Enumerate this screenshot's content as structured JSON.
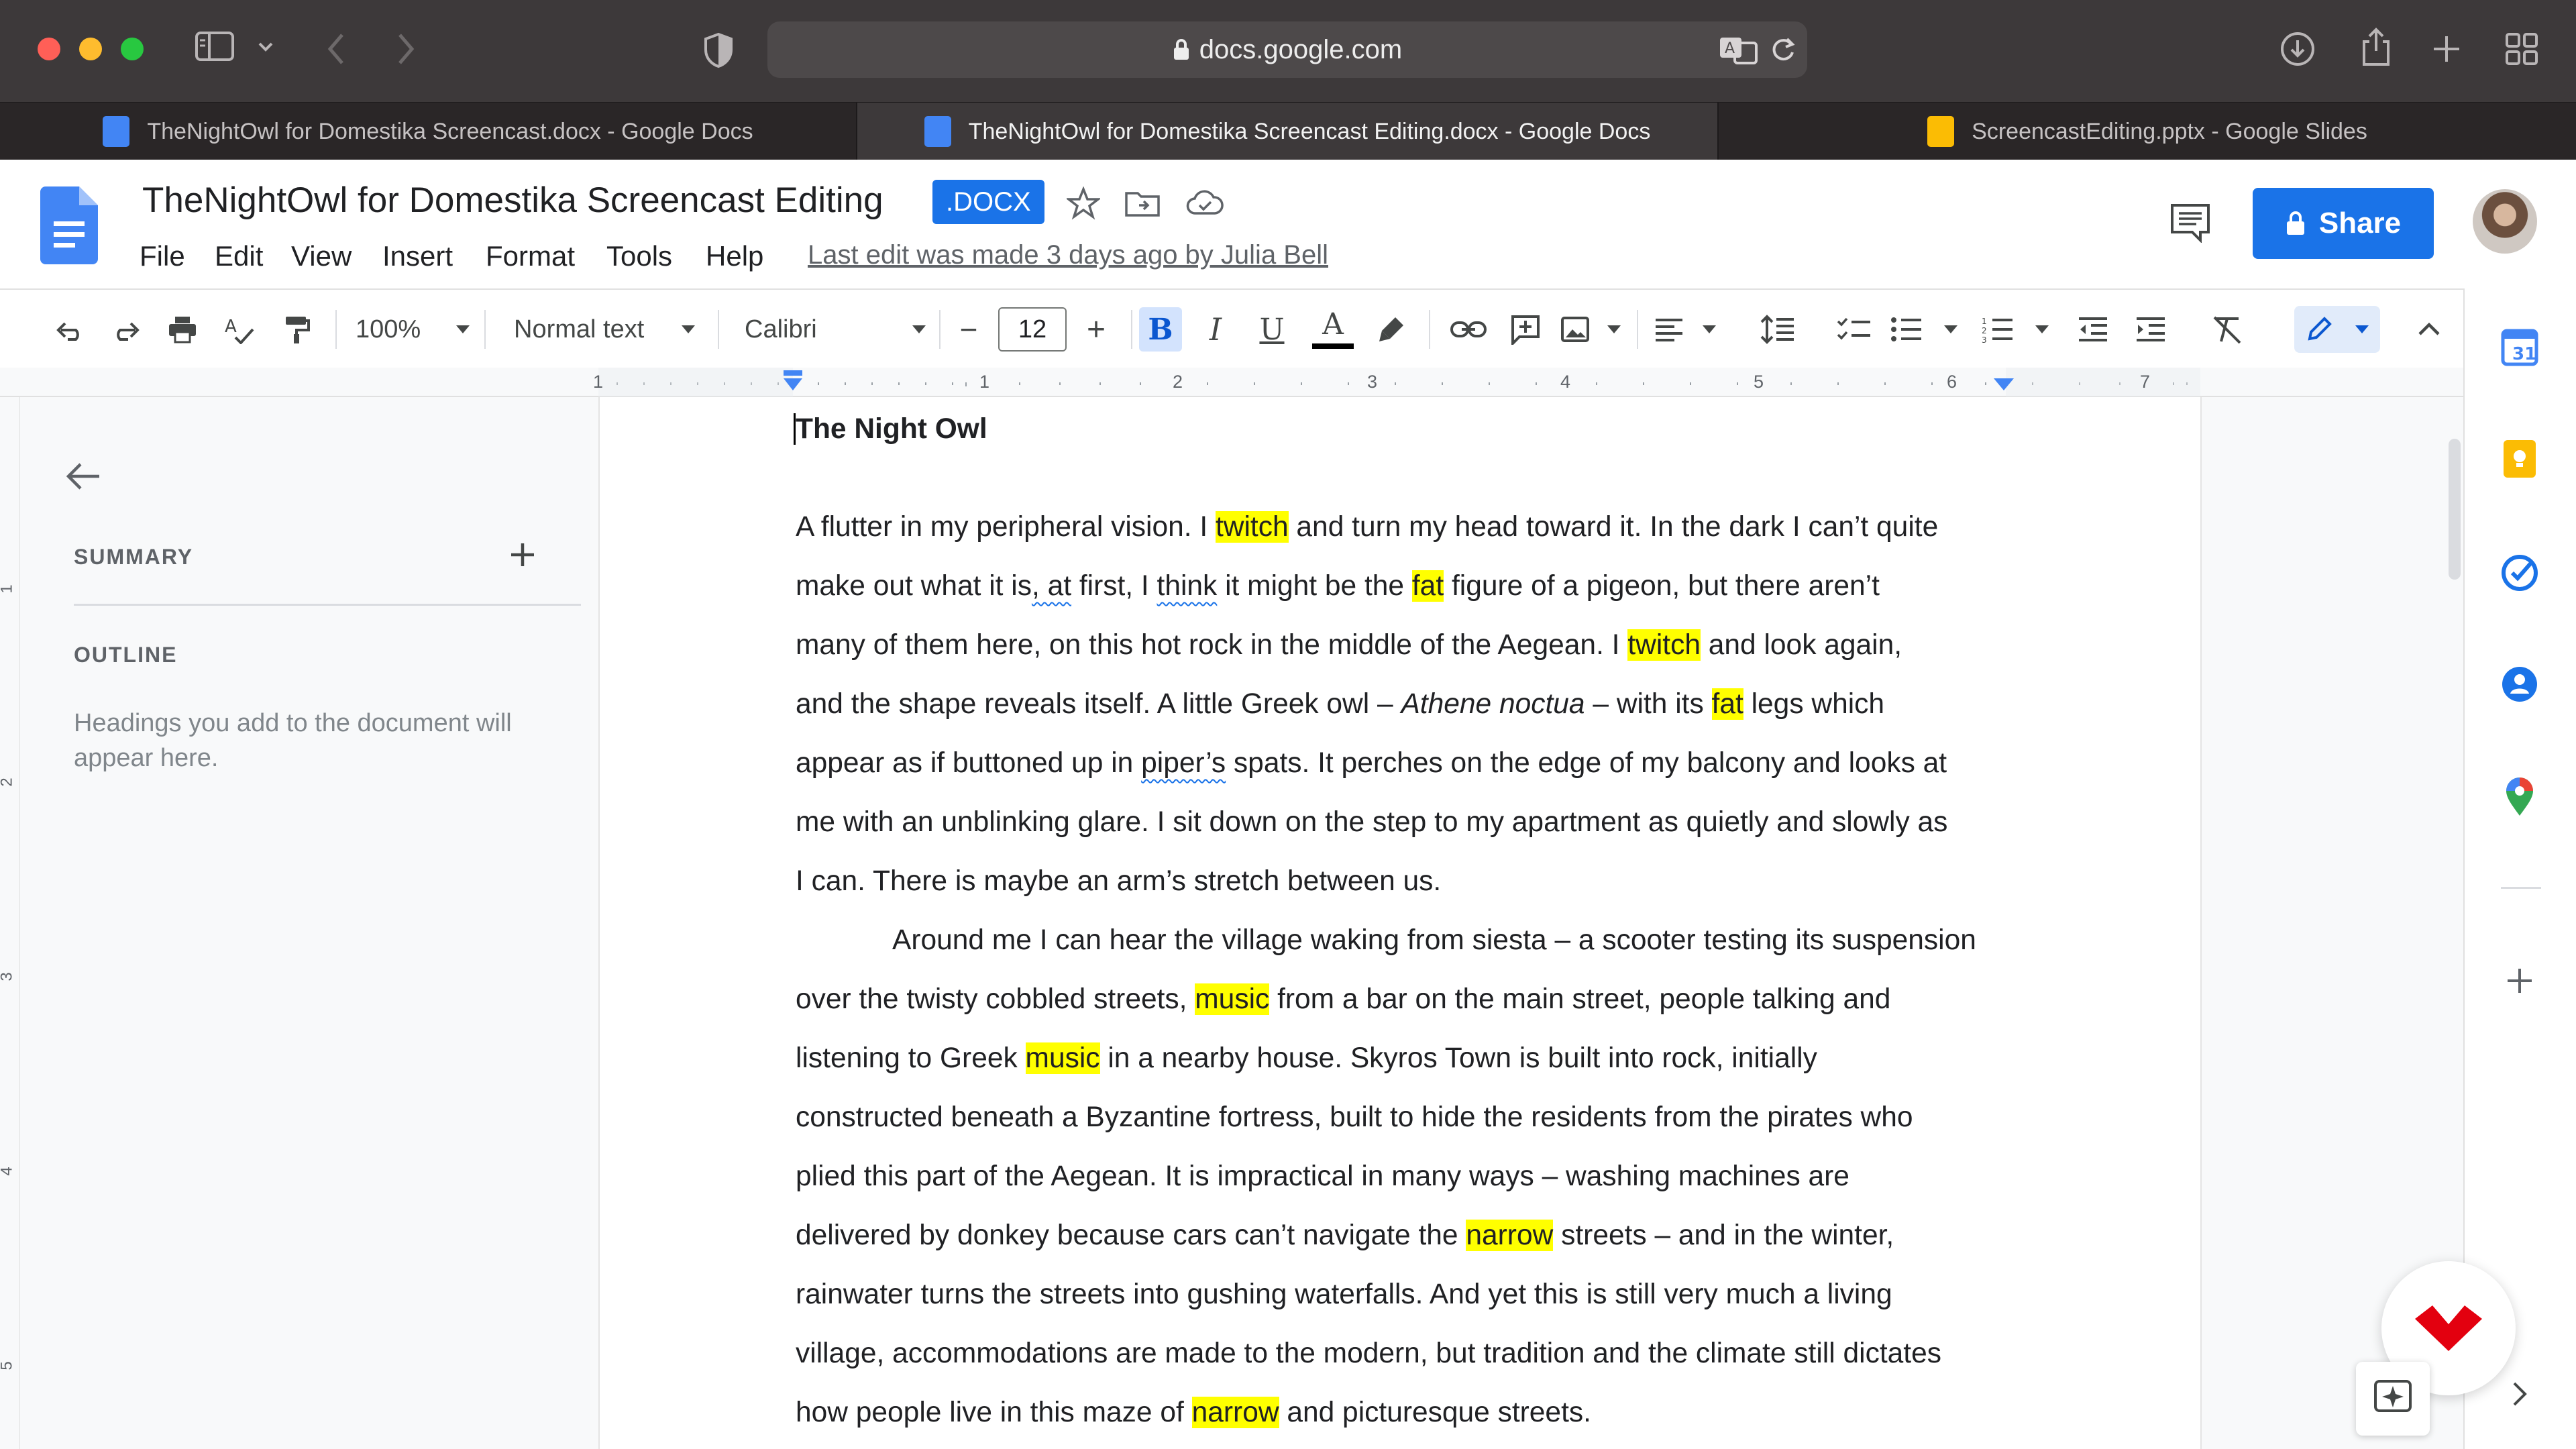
{
  "browser": {
    "url": "docs.google.com",
    "tabs": [
      {
        "label": "TheNightOwl for Domestika Screencast.docx - Google Docs",
        "app": "docs",
        "active": false
      },
      {
        "label": "TheNightOwl for Domestika Screencast Editing.docx - Google Docs",
        "app": "docs",
        "active": true
      },
      {
        "label": "ScreencastEditing.pptx - Google Slides",
        "app": "slides",
        "active": false
      }
    ]
  },
  "docs": {
    "title": "TheNightOwl for Domestika Screencast Editing",
    "badge": ".DOCX",
    "menu": [
      "File",
      "Edit",
      "View",
      "Insert",
      "Format",
      "Tools",
      "Help"
    ],
    "last_edit": "Last edit was made 3 days ago by Julia Bell",
    "share_label": "Share",
    "colors": {
      "accent": "#1a73e8",
      "highlight": "#ffff00"
    }
  },
  "toolbar": {
    "zoom": "100%",
    "style": "Normal text",
    "font": "Calibri",
    "font_size": "12",
    "decrease": "−",
    "increase": "+",
    "bold": "B",
    "italic": "I",
    "underline": "U",
    "text_color": "A"
  },
  "ruler": {
    "h_numbers": [
      "1",
      "1",
      "2",
      "3",
      "4",
      "5",
      "6",
      "7"
    ],
    "v_numbers": [
      "1",
      "2",
      "3",
      "4",
      "5"
    ]
  },
  "outline": {
    "summary_label": "SUMMARY",
    "outline_label": "OUTLINE",
    "hint": "Headings you add to the document will appear here."
  },
  "document": {
    "heading": "The Night Owl",
    "para1_lines": [
      [
        {
          "t": "A flutter in my peripheral vision. I "
        },
        {
          "t": "twitch",
          "hl": true
        },
        {
          "t": " and turn my head toward it. In the dark I can’t quite"
        }
      ],
      [
        {
          "t": "make out what it is"
        },
        {
          "t": ", at",
          "sq": true
        },
        {
          "t": " first, I "
        },
        {
          "t": "think",
          "sq": true
        },
        {
          "t": " it might be the "
        },
        {
          "t": "fat",
          "hl": true
        },
        {
          "t": " figure of a pigeon, but there aren’t"
        }
      ],
      [
        {
          "t": "many of them here, on this hot rock in the middle of the Aegean. I "
        },
        {
          "t": "twitch",
          "hl": true
        },
        {
          "t": " and look again,"
        }
      ],
      [
        {
          "t": "and the shape reveals itself. A little Greek owl – "
        },
        {
          "t": "Athene noctua",
          "it": true
        },
        {
          "t": " – with its "
        },
        {
          "t": "fat",
          "hl": true
        },
        {
          "t": " legs which"
        }
      ],
      [
        {
          "t": "appear as if buttoned up in "
        },
        {
          "t": "piper’s",
          "sq": true
        },
        {
          "t": " spats. It perches on the edge of my balcony and looks at"
        }
      ],
      [
        {
          "t": "me with an unblinking glare. I sit down on the step to my apartment as quietly and slowly as"
        }
      ],
      [
        {
          "t": "I can. There is maybe an arm’s stretch between us."
        }
      ]
    ],
    "para2_lines": [
      [
        {
          "t": "Around me I can hear the village waking from siesta – a scooter testing its suspension"
        }
      ],
      [
        {
          "t": "over the twisty cobbled streets, "
        },
        {
          "t": "music",
          "hl": true
        },
        {
          "t": " from a bar on the main street, people talking and"
        }
      ],
      [
        {
          "t": "listening to Greek "
        },
        {
          "t": "music",
          "hl": true
        },
        {
          "t": " in a nearby house. Skyros Town is built into rock, initially"
        }
      ],
      [
        {
          "t": "constructed beneath a Byzantine fortress, built to hide the residents from the pirates who"
        }
      ],
      [
        {
          "t": "plied this part of the Aegean. It is impractical in many ways – washing machines are"
        }
      ],
      [
        {
          "t": "delivered by donkey because cars can’t navigate the "
        },
        {
          "t": "narrow",
          "hl": true
        },
        {
          "t": " streets – and in the winter,"
        }
      ],
      [
        {
          "t": "rainwater turns the streets into gushing waterfalls. And yet this is still very much a living"
        }
      ],
      [
        {
          "t": "village, accommodations are made to the modern, but tradition and the climate still dictates"
        }
      ],
      [
        {
          "t": "how people live in this maze of "
        },
        {
          "t": "narrow",
          "hl": true
        },
        {
          "t": " and picturesque streets."
        }
      ]
    ]
  }
}
